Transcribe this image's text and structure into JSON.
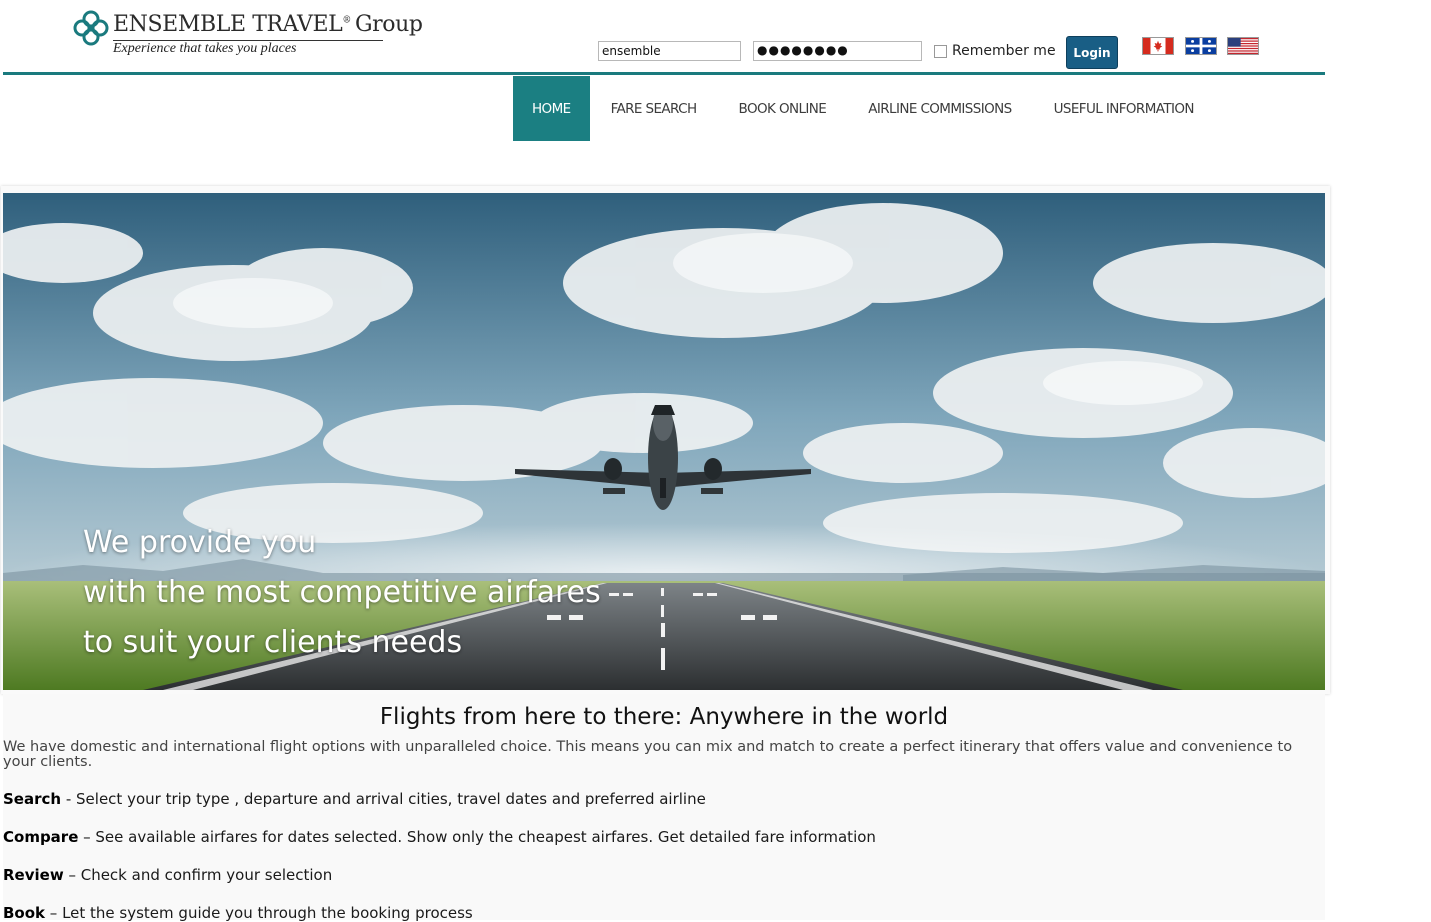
{
  "header": {
    "brand_name": "ENSEMBLE TRAVEL",
    "brand_registered": "®",
    "brand_suffix": "Group",
    "tagline": "Experience that takes you places",
    "brand_color": "#1a7a7e"
  },
  "login": {
    "username_value": "ensemble",
    "password_value": "●●●●●●●●",
    "remember_label": "Remember me",
    "remember_checked": false,
    "login_label": "Login",
    "button_color": "#195e85"
  },
  "flags": [
    {
      "name": "canada-flag"
    },
    {
      "name": "quebec-flag"
    },
    {
      "name": "usa-flag"
    }
  ],
  "nav": {
    "items": [
      {
        "label": "HOME",
        "active": true
      },
      {
        "label": "FARE SEARCH",
        "active": false
      },
      {
        "label": "BOOK ONLINE",
        "active": false
      },
      {
        "label": "AIRLINE COMMISSIONS",
        "active": false
      },
      {
        "label": "USEFUL INFORMATION",
        "active": false
      }
    ],
    "active_color": "#1b7f82"
  },
  "hero": {
    "lines": [
      "We provide you",
      "with the most competitive airfares",
      "to suit your clients needs"
    ]
  },
  "content": {
    "title": "Flights from here to there: Anywhere in the world",
    "intro": "We have domestic and international flight options with unparalleled choice. This means you can mix and match to create a perfect itinerary that offers value and convenience to your clients.",
    "steps": [
      {
        "term": "Search",
        "desc": " - Select your trip type , departure and arrival cities, travel dates and preferred airline"
      },
      {
        "term": "Compare",
        "desc": " – See available airfares for dates selected. Show only the cheapest airfares. Get detailed fare information"
      },
      {
        "term": "Review",
        "desc": " – Check and confirm your selection"
      },
      {
        "term": "Book",
        "desc": " – Let the system guide you through the booking process"
      }
    ]
  }
}
